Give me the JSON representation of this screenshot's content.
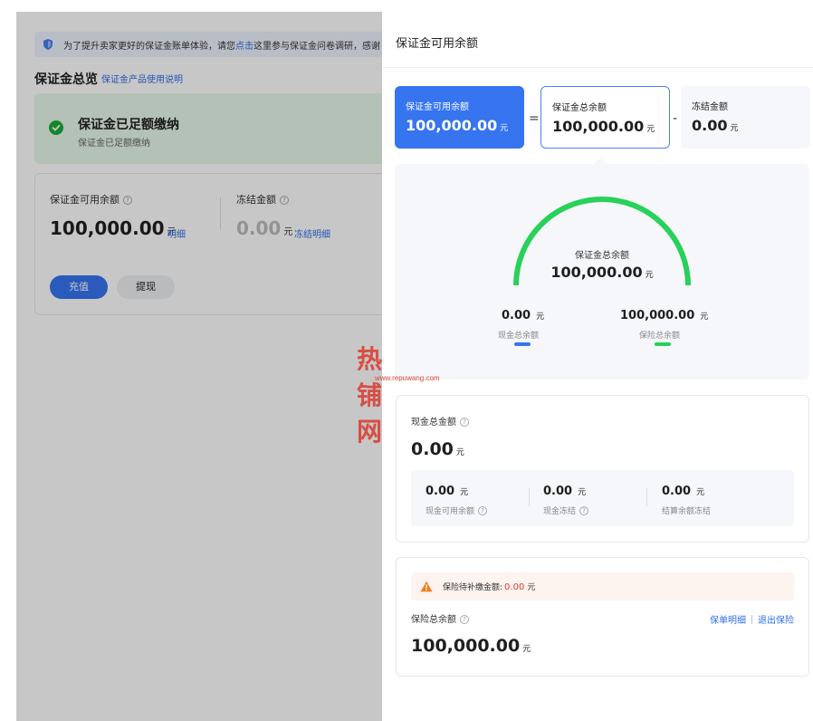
{
  "background": {
    "notice": {
      "text_before": "为了提升卖家更好的保证金账单体验，请您",
      "link": "点击",
      "text_after": "这里参与保证金问卷调研，感谢"
    },
    "overview": {
      "title": "保证金总览",
      "link": "保证金产品使用说明"
    },
    "status": {
      "title": "保证金已足额缴纳",
      "subtitle": "保证金已足额缴纳",
      "color": "#1aad3c"
    },
    "balance": {
      "available_label": "保证金可用余额",
      "available_value": "100,000.00",
      "available_unit": "元",
      "available_link": "明细",
      "frozen_label": "冻结金额",
      "frozen_value": "0.00",
      "frozen_unit": "元",
      "frozen_link": "冻结明细",
      "recharge_button": "充值",
      "withdraw_button": "提现"
    }
  },
  "drawer": {
    "title": "保证金可用余额",
    "formula": {
      "available": {
        "label": "保证金可用余额",
        "value": "100,000.00",
        "unit": "元"
      },
      "equals": "=",
      "total": {
        "label": "保证金总余额",
        "value": "100,000.00",
        "unit": "元"
      },
      "minus": "-",
      "frozen": {
        "label": "冻结金额",
        "value": "0.00",
        "unit": "元"
      }
    },
    "gauge": {
      "center_label": "保证金总余额",
      "center_value": "100,000.00",
      "center_unit": "元",
      "cash": {
        "value": "0.00",
        "unit": "元",
        "label": "现金总余额",
        "color": "#3674f0",
        "fraction": 0.0
      },
      "insurance": {
        "value": "100,000.00",
        "unit": "元",
        "label": "保险总余额",
        "color": "#27d15a",
        "fraction": 1.0
      }
    },
    "cash_card": {
      "label": "现金总金额",
      "value": "0.00",
      "unit": "元",
      "items": [
        {
          "value": "0.00",
          "unit": "元",
          "label": "现金可用余额"
        },
        {
          "value": "0.00",
          "unit": "元",
          "label": "现金冻结"
        },
        {
          "value": "0.00",
          "unit": "元",
          "label": "结算余额冻结"
        }
      ]
    },
    "insurance_card": {
      "warning_label": "保险待补缴金额:",
      "warning_value": "0.00",
      "warning_unit": "元",
      "label": "保险总余额",
      "value": "100,000.00",
      "unit": "元",
      "link_detail": "保单明细",
      "link_exit": "退出保险"
    }
  },
  "watermark": {
    "text": "热铺网",
    "url": "www.repuwang.com"
  },
  "colors": {
    "primary": "#3674f0",
    "success": "#27d15a",
    "danger": "#e23b2e",
    "warning": "#f07d1a"
  }
}
